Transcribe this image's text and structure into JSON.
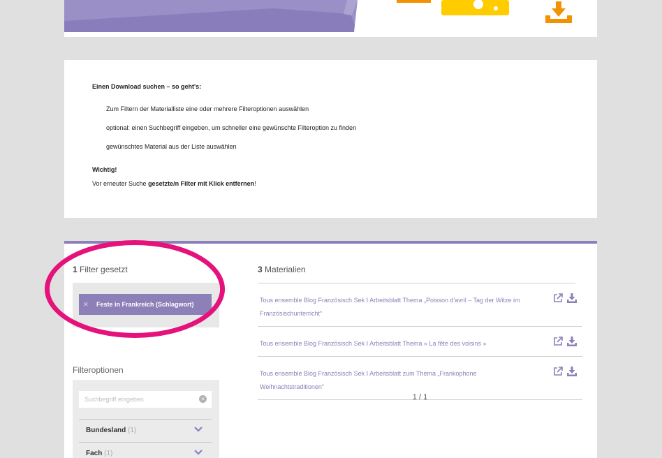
{
  "instructions": {
    "heading": "Einen Download suchen – so geht's:",
    "steps": [
      "Zum Filtern der Materialliste eine oder mehrere Filteroptionen auswählen",
      "optional: einen Suchbegriff eingeben, um schneller eine gewünschte Filteroption zu finden",
      "gewünschtes Material aus der Liste auswählen"
    ],
    "important_label": "Wichtig!",
    "important_prefix": "Vor erneuter Suche ",
    "important_bold": "gesetzte/n Filter mit Klick entfernen",
    "important_suffix": "!"
  },
  "filters_set": {
    "count": "1",
    "label": "Filter gesetzt",
    "chips": [
      "Feste in Frankreich (Schlagwort)"
    ],
    "remove_glyph": "×"
  },
  "filter_options": {
    "title": "Filteroptionen",
    "search_placeholder": "Suchbegriff eingeben",
    "rows": [
      {
        "label": "Bundesland",
        "count": "(1)"
      },
      {
        "label": "Fach",
        "count": "(1)"
      }
    ]
  },
  "materials": {
    "count": "3",
    "label": "Materialien",
    "items": [
      "Tous ensemble Blog Französisch Sek I Arbeitsblatt Thema „Poisson d'avril – Tag der Witze im Französischunterricht“",
      "Tous ensemble Blog Französisch Sek I Arbeitsblatt Thema « La fête des voisins »",
      "Tous ensemble Blog Französisch Sek I Arbeitsblatt zum Thema „Frankophone Weihnachtstraditionen“"
    ],
    "pagination": "1 / 1"
  },
  "icons": {
    "open": "external-link-icon",
    "download": "download-icon",
    "chevron": "chevron-down-icon",
    "clear": "clear-search-icon"
  },
  "colors": {
    "accent": "#8d7fb8",
    "highlight": "#e5127c",
    "banner_orange": "#f39200",
    "banner_yellow": "#ffcc00",
    "background": "#e0e0e0"
  }
}
